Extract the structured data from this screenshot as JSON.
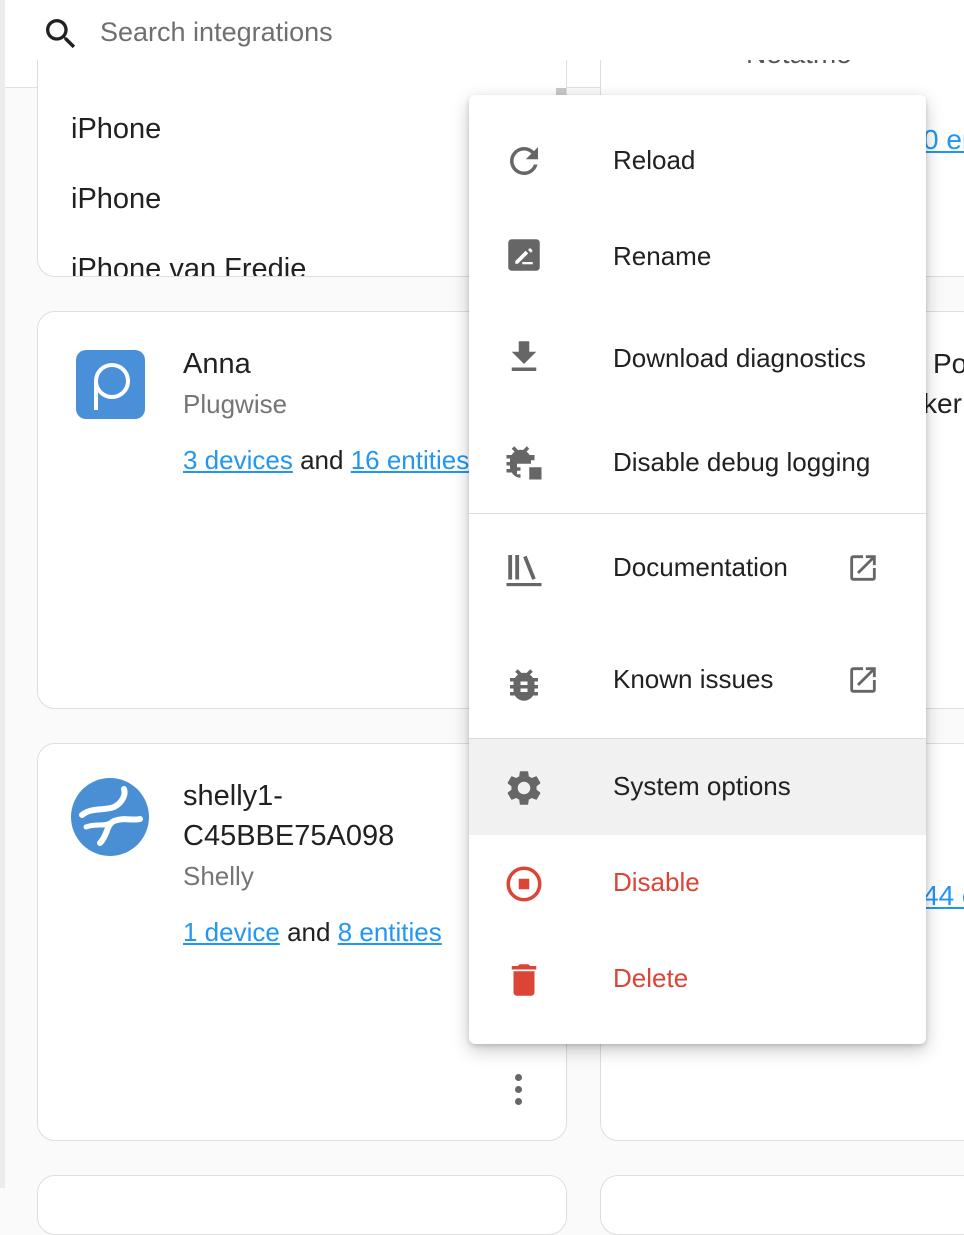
{
  "search": {
    "placeholder": "Search integrations"
  },
  "top_card": {
    "items": [
      "iPhone",
      "iPhone",
      "iPhone van Fredie"
    ]
  },
  "right_partials": {
    "top_name": "Netatmo",
    "top_link": "0 en",
    "mid_text_1": "Po",
    "mid_text_2": "ker",
    "low_link": "44 e"
  },
  "cards": [
    {
      "title": "Anna",
      "subtitle": "Plugwise",
      "devices_link": "3 devices",
      "and": "and",
      "entities_link": "16 entities",
      "logo_color": "#4a90d9"
    },
    {
      "title_line1": "shelly1-",
      "title_line2": "C45BBE75A098",
      "subtitle": "Shelly",
      "devices_link": "1 device",
      "and": "and",
      "entities_link": "8 entities",
      "logo_color": "#4a8fd4"
    }
  ],
  "menu": {
    "items": [
      {
        "label": "Reload",
        "icon": "reload-icon"
      },
      {
        "label": "Rename",
        "icon": "rename-icon"
      },
      {
        "label": "Download diagnostics",
        "icon": "download-icon"
      },
      {
        "label": "Disable debug logging",
        "icon": "bug-stop-icon"
      },
      {
        "label": "Documentation",
        "icon": "library-icon"
      },
      {
        "label": "Known issues",
        "icon": "bug-icon"
      },
      {
        "label": "System options",
        "icon": "gear-icon"
      },
      {
        "label": "Disable",
        "icon": "stop-circle-icon"
      },
      {
        "label": "Delete",
        "icon": "trash-icon"
      }
    ],
    "danger_color": "#db4437",
    "highlight_color": "#f1f1f1"
  }
}
